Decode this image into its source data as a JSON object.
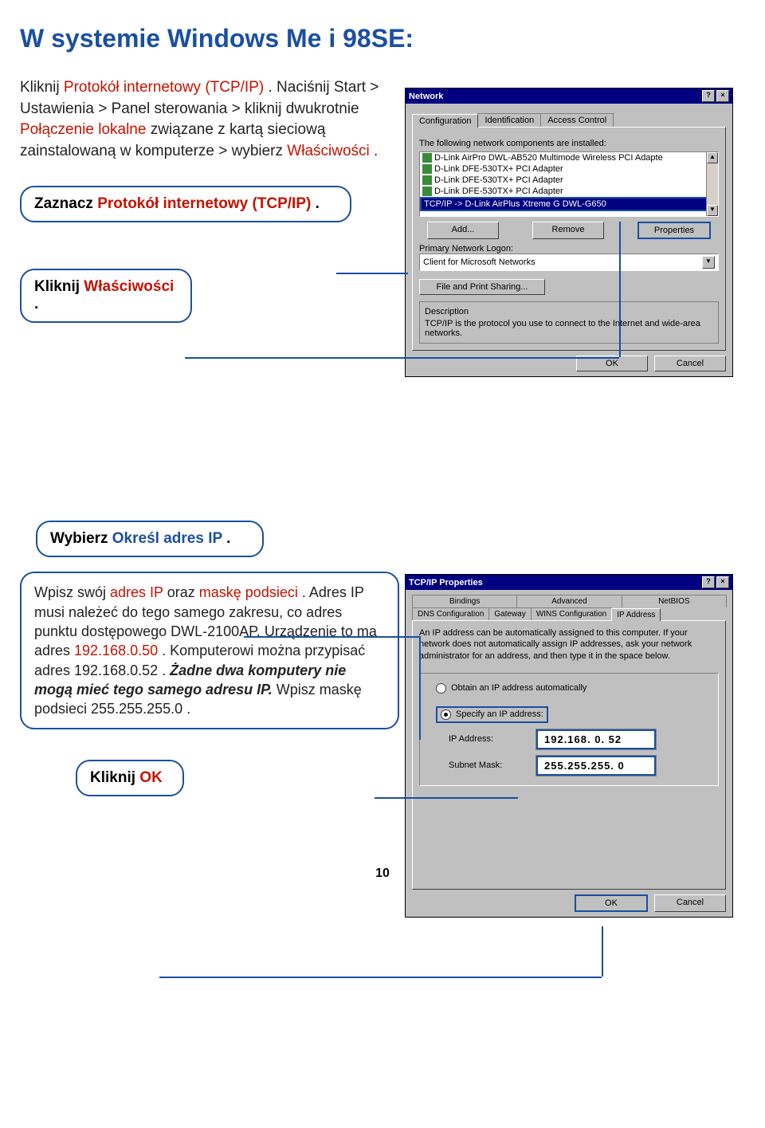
{
  "heading": "W systemie Windows Me i 98SE:",
  "intro": {
    "part1": "Kliknij ",
    "red1": "Protokół internetowy (TCP/IP)",
    "part2": ". Naciśnij Start > Ustawienia > Panel sterowania > kliknij dwukrotnie ",
    "red2": "Połączenie lokalne",
    "part3": " związane z kartą sieciową zainstalowaną w komputerze > wybierz ",
    "red3": "Właściwości",
    "part4": "."
  },
  "callouts": {
    "c1_a": "Zaznacz ",
    "c1_b": "Protokół internetowy (TCP/IP)",
    "c1_c": ".",
    "c2_a": "Kliknij ",
    "c2_b": "Właściwości",
    "c2_c": ".",
    "c3_a": "Wybierz ",
    "c3_b": "Określ adres IP",
    "c3_c": ".",
    "c4_a": "Kliknij ",
    "c4_b": "OK"
  },
  "instruction": {
    "p1": "Wpisz swój ",
    "p2": "adres IP",
    "p3": " oraz ",
    "p4": "maskę podsieci",
    "p5": ". Adres IP musi należeć do tego samego zakresu, co adres punktu dostępowego DWL-2100AP. Urządzenie to ma adres ",
    "p6": "192.168.0.50",
    "p7": ". Komputerowi można przypisać adres ",
    "p8": "192.168.0.52",
    "p9": ". ",
    "p10": "Żadne dwa komputery nie mogą mieć tego samego adresu IP.",
    "p11": " Wpisz maskę podsieci ",
    "p12": "255.255.255.0",
    "p13": "."
  },
  "page_number": "10",
  "dialog1": {
    "title": "Network",
    "tabs": [
      "Configuration",
      "Identification",
      "Access Control"
    ],
    "list_label": "The following network components are installed:",
    "items": [
      "D-Link AirPro DWL-AB520 Multimode Wireless PCI Adapte",
      "D-Link DFE-530TX+ PCI Adapter",
      "D-Link DFE-530TX+ PCI Adapter",
      "D-Link DFE-530TX+ PCI Adapter"
    ],
    "item_sel": "TCP/IP -> D-Link AirPlus Xtreme G DWL-G650",
    "btn_add": "Add...",
    "btn_remove": "Remove",
    "btn_props": "Properties",
    "logon_label": "Primary Network Logon:",
    "logon_value": "Client for Microsoft Networks",
    "btn_fps": "File and Print Sharing...",
    "desc_label": "Description",
    "desc_text": "TCP/IP is the protocol you use to connect to the Internet and wide-area networks.",
    "btn_ok": "OK",
    "btn_cancel": "Cancel"
  },
  "dialog2": {
    "title": "TCP/IP Properties",
    "tabs_row1": [
      "Bindings",
      "Advanced",
      "NetBIOS"
    ],
    "tabs_row2": [
      "DNS Configuration",
      "Gateway",
      "WINS Configuration",
      "IP Address"
    ],
    "desc": "An IP address can be automatically assigned to this computer. If your network does not automatically assign IP addresses, ask your network administrator for an address, and then type it in the space below.",
    "radio1": "Obtain an IP address automatically",
    "radio2": "Specify an IP address:",
    "ip_label": "IP Address:",
    "ip_value": "192.168.  0. 52",
    "mask_label": "Subnet Mask:",
    "mask_value": "255.255.255.  0",
    "btn_ok": "OK",
    "btn_cancel": "Cancel"
  }
}
